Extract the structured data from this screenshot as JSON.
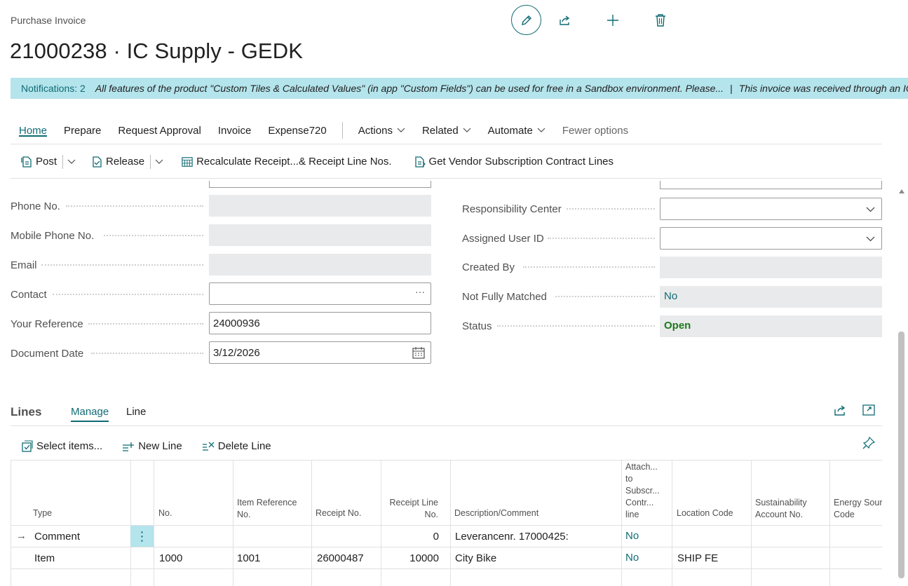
{
  "page": {
    "caption": "Purchase Invoice",
    "title": "21000238 · IC Supply - GEDK"
  },
  "notification": {
    "count_label": "Notifications: 2",
    "message_1": "All features of the product \"Custom Tiles & Calculated Values\" (in app \"Custom Fields\") can be used for free in a Sandbox environment. Please...",
    "separator": "|",
    "message_2": "This invoice was received through an IC transaction"
  },
  "menu": {
    "home": "Home",
    "prepare": "Prepare",
    "request_approval": "Request Approval",
    "invoice": "Invoice",
    "expense720": "Expense720",
    "actions": "Actions",
    "related": "Related",
    "automate": "Automate",
    "fewer_options": "Fewer options"
  },
  "toolbar": {
    "post": "Post",
    "release": "Release",
    "recalculate": "Recalculate Receipt...& Receipt Line Nos.",
    "get_vendor_sub": "Get Vendor Subscription Contract Lines"
  },
  "left_fields": {
    "phone_no": {
      "label": "Phone No.",
      "value": ""
    },
    "mobile_phone_no": {
      "label": "Mobile Phone No.",
      "value": ""
    },
    "email": {
      "label": "Email",
      "value": ""
    },
    "contact": {
      "label": "Contact",
      "value": "",
      "button": "···"
    },
    "your_reference": {
      "label": "Your Reference",
      "value": "24000936"
    },
    "document_date": {
      "label": "Document Date",
      "value": "3/12/2026"
    }
  },
  "right_fields": {
    "responsibility_center": {
      "label": "Responsibility Center",
      "value": ""
    },
    "assigned_user_id": {
      "label": "Assigned User ID",
      "value": ""
    },
    "created_by": {
      "label": "Created By",
      "value": ""
    },
    "not_fully_matched": {
      "label": "Not Fully Matched",
      "value": "No"
    },
    "status": {
      "label": "Status",
      "value": "Open"
    }
  },
  "lines": {
    "title": "Lines",
    "tab_manage": "Manage",
    "tab_line": "Line",
    "select_items": "Select items...",
    "new_line": "New Line",
    "delete_line": "Delete Line",
    "headers": {
      "type": "Type",
      "no": "No.",
      "item_ref_1": "Item Reference",
      "item_ref_2": "No.",
      "receipt_no": "Receipt No.",
      "receipt_line_1": "Receipt Line",
      "receipt_line_2": "No.",
      "description": "Description/Comment",
      "attach_1": "Attach...",
      "attach_2": "to",
      "attach_3": "Subscr...",
      "attach_4": "Contr...",
      "attach_5": "line",
      "location_code": "Location Code",
      "sust_1": "Sustainability",
      "sust_2": "Account No.",
      "energy_1": "Energy Sour",
      "energy_2": "Code"
    },
    "rows": [
      {
        "type": "Comment",
        "no": "",
        "item_ref": "",
        "receipt_no": "",
        "receipt_line": "0",
        "description": "Leverancenr. 17000425:",
        "attach": "No",
        "location": "",
        "sust": "",
        "energy": ""
      },
      {
        "type": "Item",
        "no": "1000",
        "item_ref": "1001",
        "receipt_no": "26000487",
        "receipt_line": "10000",
        "description": "City Bike",
        "attach": "No",
        "location": "SHIP FE",
        "sust": "",
        "energy": ""
      }
    ],
    "current_row_marker": "→",
    "kebab": "⋮"
  },
  "colors": {
    "accent": "#0f6b73",
    "notification_bg": "#b4e4ec",
    "status_open": "#1c7a1c",
    "readonly_bg": "#e9eaeb"
  }
}
